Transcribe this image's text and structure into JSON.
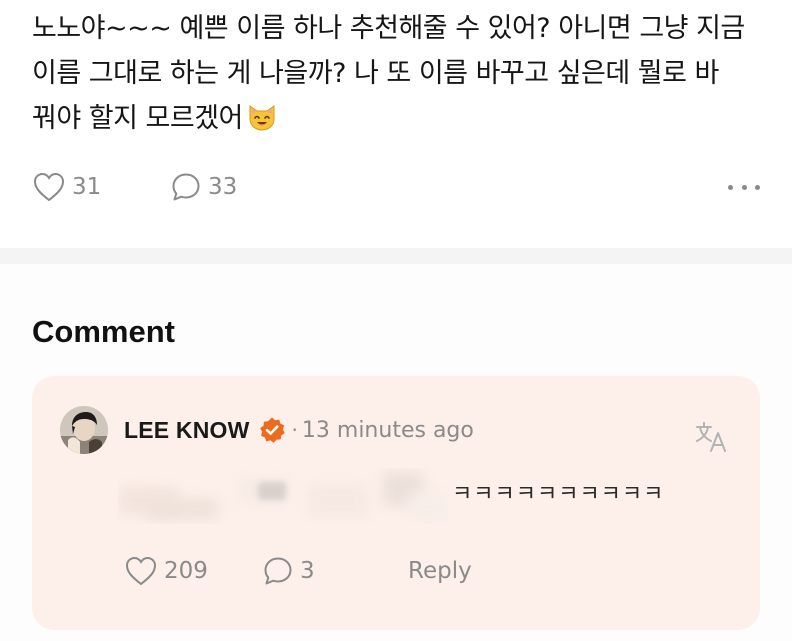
{
  "post": {
    "text_line1": "노노야~~~ 예쁜 이름 하나 추천해줄 수 있어? 아니면 그냥 지금",
    "text_line2": "이름 그대로 하는 게 나을까? 나 또 이름 바꾸고 싶은데 뭘로 바",
    "text_line3": "꿔야 할지 모르겠어",
    "emoji": "cat-face-emoji",
    "likes": "31",
    "comments": "33",
    "more_icon": "more-horizontal-icon"
  },
  "comment_section": {
    "heading": "Comment"
  },
  "comment": {
    "author": "LEE KNOW",
    "verified_icon": "verified-badge-icon",
    "separator": "·",
    "time": "13 minutes ago",
    "translate_icon": "translate-icon",
    "text_visible": "ㅋㅋㅋㅋㅋㅋㅋㅋㅋㅋ",
    "likes": "209",
    "replies": "3",
    "reply_label": "Reply"
  },
  "colors": {
    "card_background": "#fdf0ea",
    "verified_badge": "#f06a1d",
    "muted_text": "#8a8a8a",
    "divider": "#f4f4f4"
  }
}
